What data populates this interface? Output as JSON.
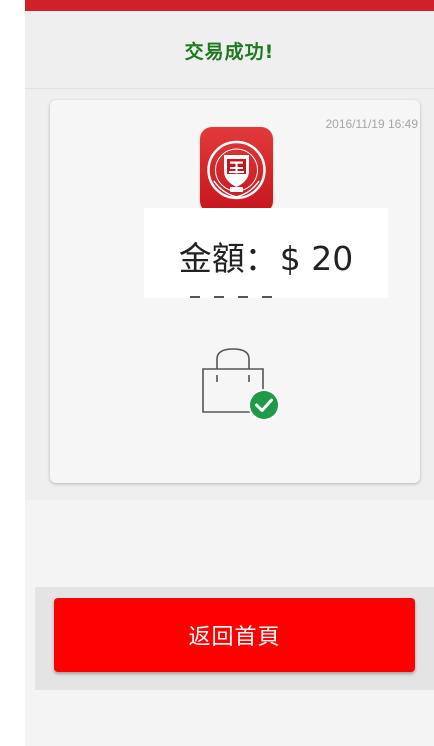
{
  "header": {
    "title": "交易成功!"
  },
  "receipt": {
    "timestamp": "2016/11/19 16:49",
    "amount_label": "金額：",
    "amount_value": "$ 20",
    "logo_icon": "taipei-medical-university-logo",
    "status_icon": "shopping-bag-check-icon"
  },
  "actions": {
    "home_button_label": "返回首頁"
  },
  "colors": {
    "top_strip": "#d0202a",
    "title": "#1f7a1f",
    "button": "#ff0000",
    "check": "#1e9a48"
  }
}
